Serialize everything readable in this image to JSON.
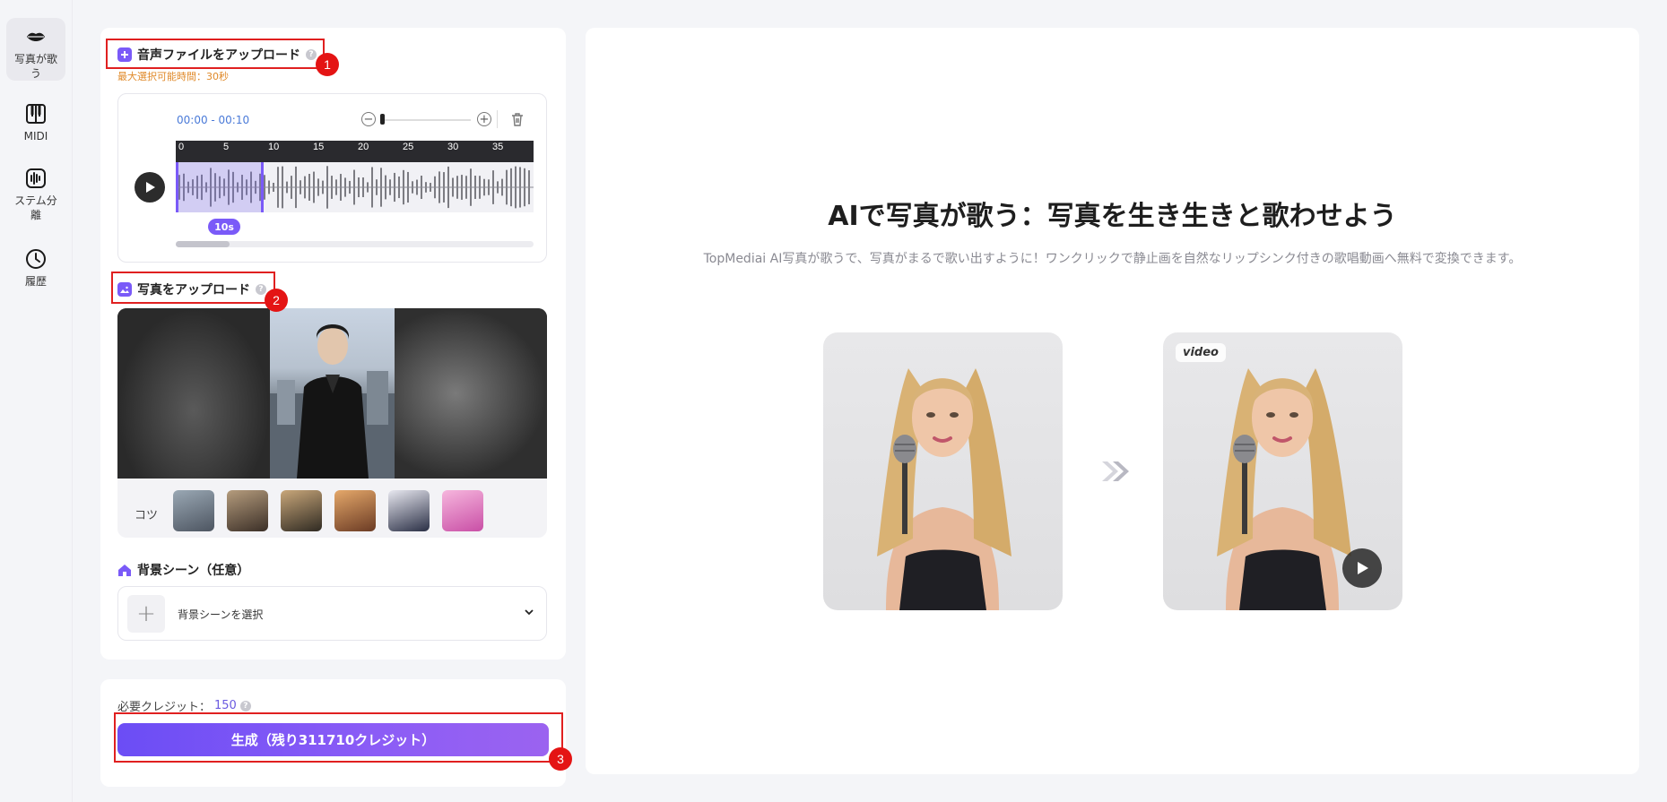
{
  "sidebar": {
    "items": [
      {
        "label": "写真が歌う",
        "icon": "lips-icon",
        "active": true
      },
      {
        "label": "MIDI",
        "icon": "piano-icon"
      },
      {
        "label": "ステム分離",
        "icon": "waveform-icon"
      },
      {
        "label": "履歴",
        "icon": "clock-icon"
      }
    ]
  },
  "audio": {
    "title": "音声ファイルをアップロード",
    "hint": "最大選択可能時間：30秒",
    "time_range": "00:00 - 00:10",
    "ticks": [
      "0",
      "5",
      "10",
      "15",
      "20",
      "25",
      "30",
      "35"
    ],
    "selection_label": "10s"
  },
  "photo": {
    "title": "写真をアップロード",
    "tips_label": "コツ"
  },
  "background": {
    "title": "背景シーン（任意）",
    "placeholder": "背景シーンを選択"
  },
  "generate": {
    "credits_label": "必要クレジット：",
    "credits_value": "150",
    "button_label": "生成（残り311710クレジット）"
  },
  "annotations": [
    "1",
    "2",
    "3"
  ],
  "hero": {
    "title": "AIで写真が歌う：写真を生き生きと歌わせよう",
    "description": "TopMediai AI写真が歌うで、写真がまるで歌い出すように！ワンクリックで静止画を自然なリップシンク付きの歌唱動画へ無料で変換できます。",
    "video_tag": "video"
  },
  "colors": {
    "accent": "#7a5af8",
    "annotation_red": "#e02020",
    "hint_orange": "#e08a2a"
  }
}
